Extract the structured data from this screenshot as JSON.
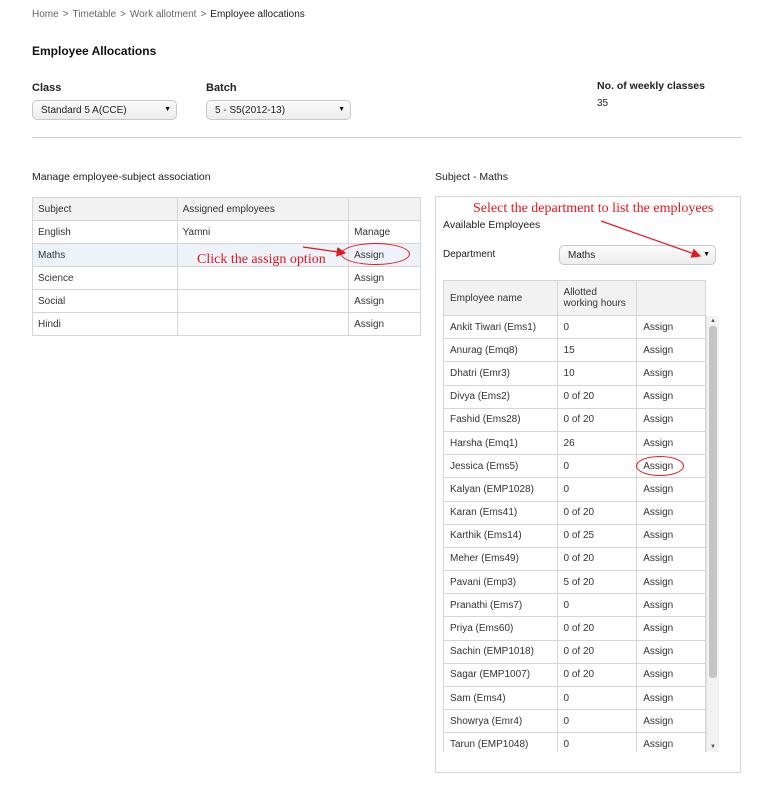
{
  "breadcrumb": {
    "items": [
      "Home",
      "Timetable",
      "Work allotment"
    ],
    "current": "Employee allocations",
    "separator": ">"
  },
  "page": {
    "title": "Employee Allocations"
  },
  "filters": {
    "class_label": "Class",
    "class_value": "Standard 5 A(CCE)",
    "batch_label": "Batch",
    "batch_value": "5 - S5(2012-13)",
    "weekly_label": "No. of weekly classes",
    "weekly_value": "35"
  },
  "manage": {
    "title": "Manage employee-subject association",
    "headers": [
      "Subject",
      "Assigned employees",
      ""
    ],
    "rows": [
      {
        "subject": "English",
        "assigned": "Yamni",
        "action": "Manage"
      },
      {
        "subject": "Maths",
        "assigned": "",
        "action": "Assign"
      },
      {
        "subject": "Science",
        "assigned": "",
        "action": "Assign"
      },
      {
        "subject": "Social",
        "assigned": "",
        "action": "Assign"
      },
      {
        "subject": "Hindi",
        "assigned": "",
        "action": "Assign"
      }
    ]
  },
  "subject_panel": {
    "title": "Subject - Maths",
    "available_title": "Available Employees",
    "department_label": "Department",
    "department_value": "Maths",
    "headers": [
      "Employee name",
      "Allotted working hours",
      ""
    ],
    "rows": [
      {
        "name": "Ankit Tiwari (Ems1)",
        "hours": "0",
        "action": "Assign"
      },
      {
        "name": "Anurag (Emq8)",
        "hours": "15",
        "action": "Assign"
      },
      {
        "name": "Dhatri (Emr3)",
        "hours": "10",
        "action": "Assign"
      },
      {
        "name": "Divya (Ems2)",
        "hours": "0 of 20",
        "action": "Assign"
      },
      {
        "name": "Fashid (Ems28)",
        "hours": "0 of 20",
        "action": "Assign"
      },
      {
        "name": "Harsha (Emq1)",
        "hours": "26",
        "action": "Assign"
      },
      {
        "name": "Jessica (Ems5)",
        "hours": "0",
        "action": "Assign"
      },
      {
        "name": "Kalyan (EMP1028)",
        "hours": "0",
        "action": "Assign"
      },
      {
        "name": "Karan (Ems41)",
        "hours": "0 of 20",
        "action": "Assign"
      },
      {
        "name": "Karthik (Ems14)",
        "hours": "0 of 25",
        "action": "Assign"
      },
      {
        "name": "Meher (Ems49)",
        "hours": "0 of 20",
        "action": "Assign"
      },
      {
        "name": "Pavani (Emp3)",
        "hours": "5 of 20",
        "action": "Assign"
      },
      {
        "name": "Pranathi (Ems7)",
        "hours": "0",
        "action": "Assign"
      },
      {
        "name": "Priya (Ems60)",
        "hours": "0 of 20",
        "action": "Assign"
      },
      {
        "name": "Sachin (EMP1018)",
        "hours": "0 of 20",
        "action": "Assign"
      },
      {
        "name": "Sagar (EMP1007)",
        "hours": "0 of 20",
        "action": "Assign"
      },
      {
        "name": "Sam (Ems4)",
        "hours": "0",
        "action": "Assign"
      },
      {
        "name": "Showrya (Emr4)",
        "hours": "0",
        "action": "Assign"
      },
      {
        "name": "Tarun (EMP1048)",
        "hours": "0",
        "action": "Assign"
      }
    ]
  },
  "annotations": {
    "click_assign": "Click the assign option",
    "select_department": "Select the department to list the employees",
    "color": "#e8141c"
  }
}
